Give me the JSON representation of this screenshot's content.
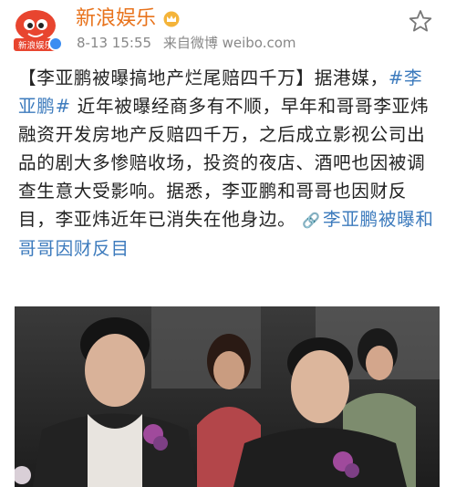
{
  "account": {
    "name": "新浪娱乐",
    "avatar_text": "新浪娱乐",
    "time": "8-13 15:55",
    "source": "来自微博 weibo.com"
  },
  "post": {
    "headline": "【李亚鹏被曝搞地产烂尾赔四千万】",
    "text1": "据港媒，",
    "topic": "#李亚鹏#",
    "text2": "近年被曝经商多有不顺，早年和哥哥李亚炜融资开发房地产反赔四千万，之后成立影视公司出品的剧大多惨赔收场，投资的夜店、酒吧也因被调查生意大受影响。据悉，李亚鹏和哥哥也因财反目，李亚炜近年已消失在他身边。",
    "link_text": "李亚鹏被曝和哥哥因财反目"
  },
  "colors": {
    "accent": "#e8731c",
    "link": "#3d7bbd",
    "meta": "#888888"
  },
  "icons": {
    "favorite": "star-icon",
    "verified": "verified-badge-icon",
    "link": "link-icon"
  }
}
